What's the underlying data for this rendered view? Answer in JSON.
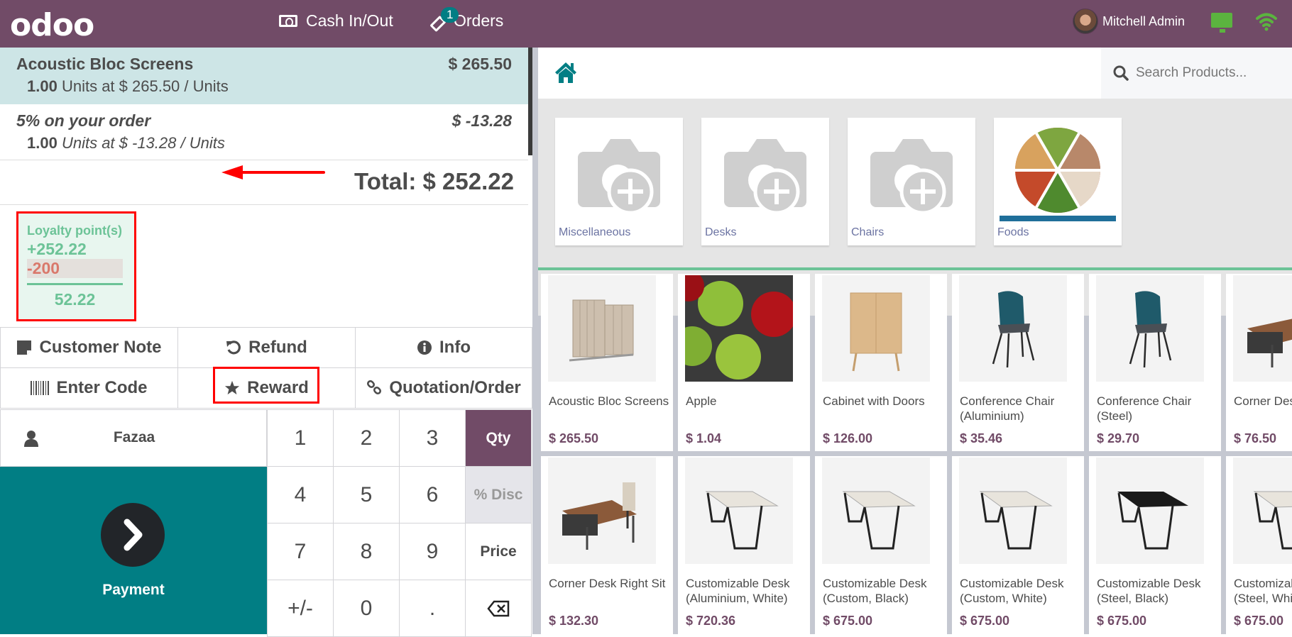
{
  "header": {
    "logo": "odoo",
    "nav": [
      {
        "label": "Cash In/Out",
        "icon": "money-bill-icon"
      },
      {
        "label": "Orders",
        "icon": "ticket-icon",
        "badge": "1"
      }
    ],
    "user_name": "Mitchell Admin",
    "status_icons": [
      "monitor-icon",
      "wifi-icon"
    ],
    "colors": {
      "brand": "#714B67",
      "status_ok": "#5bb33f",
      "badge": "#017e84"
    }
  },
  "order": {
    "lines": [
      {
        "name": "Acoustic Bloc Screens",
        "price": "$ 265.50",
        "qty": "1.00",
        "info": "Units at $ 265.50 / Units",
        "selected": true
      },
      {
        "name": "5% on your order",
        "price": "$ -13.28",
        "qty": "1.00",
        "info": "Units at $ -13.28 / Units",
        "selected": false
      }
    ],
    "total_label": "Total: $ 252.22"
  },
  "loyalty": {
    "title": "Loyalty point(s)",
    "won": "+252.22",
    "spent": "-200",
    "balance": "52.22"
  },
  "controls": [
    {
      "label": "Customer Note",
      "icon": "note-icon"
    },
    {
      "label": "Refund",
      "icon": "undo-icon"
    },
    {
      "label": "Info",
      "icon": "info-circle-icon"
    },
    {
      "label": "Enter Code",
      "icon": "barcode-icon"
    },
    {
      "label": "Reward",
      "icon": "star-icon"
    },
    {
      "label": "Quotation/Order",
      "icon": "link-icon"
    }
  ],
  "numpad": {
    "customer": "Fazaa",
    "payment_label": "Payment",
    "keys": [
      "1",
      "2",
      "3",
      "Qty",
      "4",
      "5",
      "6",
      "% Disc",
      "7",
      "8",
      "9",
      "Price",
      "+/-",
      "0",
      ".",
      "backspace"
    ],
    "active_mode": "Qty",
    "disabled_mode": "% Disc"
  },
  "search": {
    "placeholder": "Search Products..."
  },
  "categories": [
    {
      "name": "Miscellaneous",
      "image": "placeholder-camera"
    },
    {
      "name": "Desks",
      "image": "placeholder-camera"
    },
    {
      "name": "Chairs",
      "image": "placeholder-camera"
    },
    {
      "name": "Foods",
      "image": "food-photo"
    }
  ],
  "products": [
    {
      "name": "Acoustic Bloc Screens",
      "price": "$ 265.50",
      "image": "screens"
    },
    {
      "name": "Apple",
      "price": "$ 1.04",
      "image": "apple"
    },
    {
      "name": "Cabinet with Doors",
      "price": "$ 126.00",
      "image": "cabinet"
    },
    {
      "name": "Conference Chair (Aluminium)",
      "price": "$ 35.46",
      "image": "chair"
    },
    {
      "name": "Conference Chair (Steel)",
      "price": "$ 29.70",
      "image": "chair"
    },
    {
      "name": "Corner Desk Left Sit",
      "price": "$ 76.50",
      "image": "corner-desk"
    },
    {
      "name": "Corner Desk Right Sit",
      "price": "$ 132.30",
      "image": "corner-desk"
    },
    {
      "name": "Customizable Desk (Aluminium, White)",
      "price": "$ 720.36",
      "image": "desk-white"
    },
    {
      "name": "Customizable Desk (Custom, Black)",
      "price": "$ 675.00",
      "image": "desk-white"
    },
    {
      "name": "Customizable Desk (Custom, White)",
      "price": "$ 675.00",
      "image": "desk-white"
    },
    {
      "name": "Customizable Desk (Steel, Black)",
      "price": "$ 675.00",
      "image": "desk-black"
    },
    {
      "name": "Customizable Desk (Steel, White)",
      "price": "$ 675.00",
      "image": "desk-white"
    }
  ]
}
